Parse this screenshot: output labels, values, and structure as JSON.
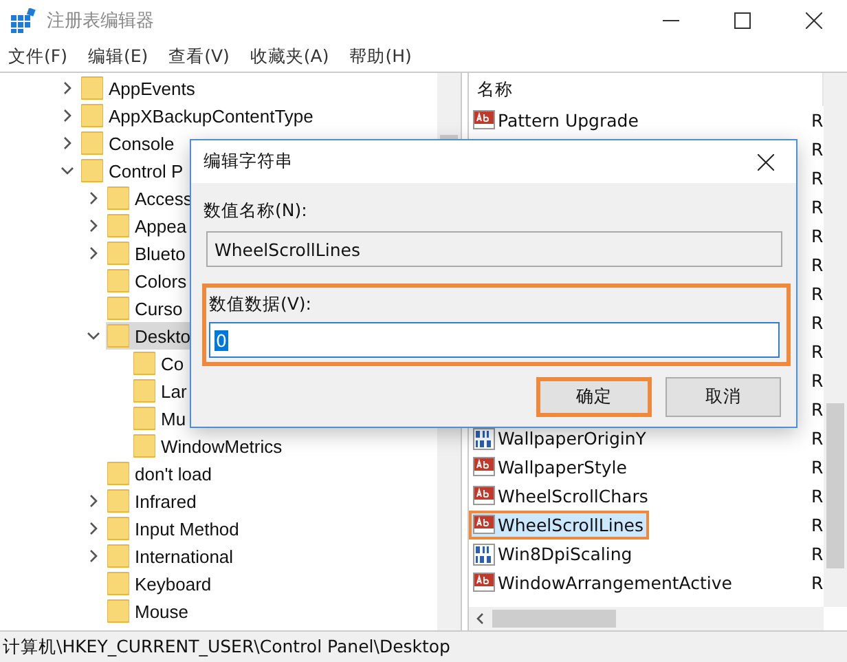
{
  "window": {
    "title": "注册表编辑器"
  },
  "menu": [
    "文件(F)",
    "编辑(E)",
    "查看(V)",
    "收藏夹(A)",
    "帮助(H)"
  ],
  "tree": [
    {
      "label": "AppEvents",
      "expandable": true,
      "expanded": false,
      "selected": false
    },
    {
      "label": "AppXBackupContentType",
      "expandable": true,
      "expanded": false,
      "selected": false
    },
    {
      "label": "Console",
      "expandable": true,
      "expanded": false,
      "selected": false
    },
    {
      "label": "Control P",
      "expandable": true,
      "expanded": true,
      "selected": false,
      "children": [
        {
          "label": "Access",
          "expandable": true,
          "expanded": false,
          "selected": false
        },
        {
          "label": "Appea",
          "expandable": true,
          "expanded": false,
          "selected": false
        },
        {
          "label": "Blueto",
          "expandable": true,
          "expanded": false,
          "selected": false
        },
        {
          "label": "Colors",
          "expandable": false,
          "selected": false
        },
        {
          "label": "Curso",
          "expandable": false,
          "selected": false
        },
        {
          "label": "Deskto",
          "expandable": true,
          "expanded": true,
          "selected": true,
          "children": [
            {
              "label": "Co",
              "expandable": false,
              "selected": false
            },
            {
              "label": "Lar",
              "expandable": false,
              "selected": false
            },
            {
              "label": "Mu",
              "expandable": false,
              "selected": false
            },
            {
              "label": "WindowMetrics",
              "expandable": false,
              "selected": false
            }
          ]
        },
        {
          "label": "don't load",
          "expandable": false,
          "selected": false
        },
        {
          "label": "Infrared",
          "expandable": true,
          "expanded": false,
          "selected": false
        },
        {
          "label": "Input Method",
          "expandable": true,
          "expanded": false,
          "selected": false
        },
        {
          "label": "International",
          "expandable": true,
          "expanded": false,
          "selected": false
        },
        {
          "label": "Keyboard",
          "expandable": false,
          "selected": false
        },
        {
          "label": "Mouse",
          "expandable": false,
          "selected": false
        }
      ]
    }
  ],
  "list": {
    "header": "名称",
    "rows": [
      {
        "name": "Pattern Upgrade",
        "kind": "string",
        "type": "R",
        "selected": false,
        "highlighted": false
      },
      {
        "type": "R"
      },
      {
        "type": "R"
      },
      {
        "type": "R"
      },
      {
        "type": "R"
      },
      {
        "type": "R"
      },
      {
        "type": "R"
      },
      {
        "type": "R"
      },
      {
        "type": "R"
      },
      {
        "type": "R"
      },
      {
        "type": "R"
      },
      {
        "name": "WallpaperOriginY",
        "kind": "binary",
        "type": "R",
        "selected": false,
        "highlighted": false
      },
      {
        "name": "WallpaperStyle",
        "kind": "string",
        "type": "R",
        "selected": false,
        "highlighted": false
      },
      {
        "name": "WheelScrollChars",
        "kind": "string",
        "type": "R",
        "selected": false,
        "highlighted": false
      },
      {
        "name": "WheelScrollLines",
        "kind": "string",
        "type": "R",
        "selected": true,
        "highlighted": true
      },
      {
        "name": "Win8DpiScaling",
        "kind": "binary",
        "type": "R",
        "selected": false,
        "highlighted": false
      },
      {
        "name": "WindowArrangementActive",
        "kind": "string",
        "type": "R",
        "selected": false,
        "highlighted": false
      }
    ]
  },
  "dialog": {
    "title": "编辑字符串",
    "name_label": "数值名称(N):",
    "name_value": "WheelScrollLines",
    "data_label": "数值数据(V):",
    "data_value": "0",
    "data_highlighted": true,
    "buttons": [
      {
        "label": "确定",
        "highlighted": true
      },
      {
        "label": "取消",
        "highlighted": false
      }
    ]
  },
  "status_bar": "计算机\\HKEY_CURRENT_USER\\Control Panel\\Desktop"
}
